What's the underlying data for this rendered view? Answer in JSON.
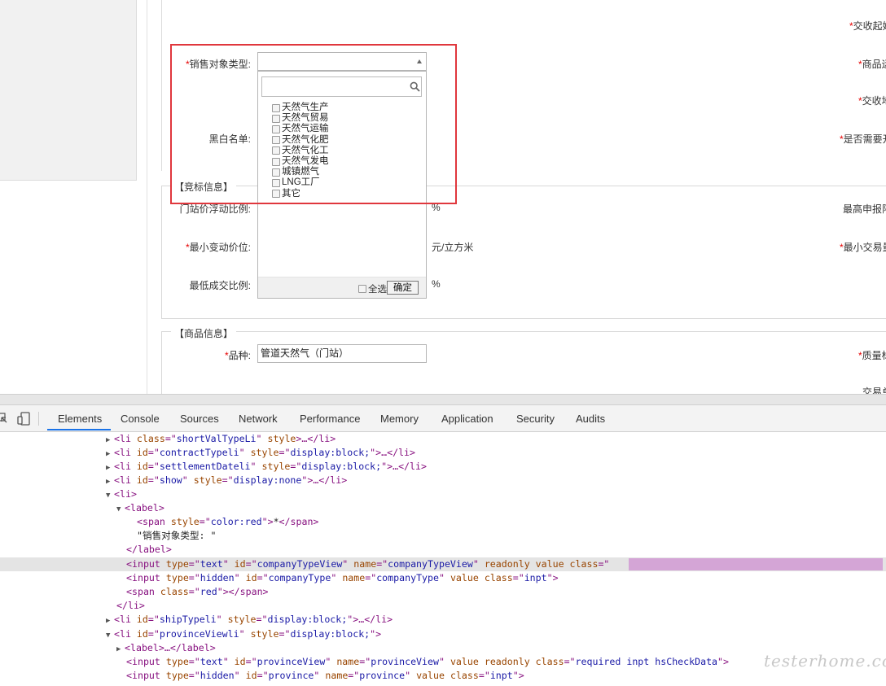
{
  "form": {
    "right_labels": [
      "*交收起始",
      "*商品运",
      "*交收地",
      "*是否需要开",
      "最高申报限",
      "*最小交易量",
      "*质量标",
      "交易单"
    ],
    "sales_target_label": "销售对象类型:",
    "sales_target_required_mark": "*",
    "blacklist_label": "黑白名单:",
    "bidding_section_legend": "【竞标信息】",
    "gate_price_label": "门站价浮动比例:",
    "gate_price_unit": "%",
    "min_change_label": "最小变动价位:",
    "min_change_required_mark": "*",
    "min_change_unit": "元/立方米",
    "min_deal_label": "最低成交比例:",
    "min_deal_unit": "%",
    "goods_section_legend": "【商品信息】",
    "variety_label": "品种:",
    "variety_required_mark": "*",
    "variety_value": "管道天然气（门站）"
  },
  "dropdown": {
    "search_value": "",
    "options": [
      "天然气生产",
      "天然气贸易",
      "天然气运输",
      "天然气化肥",
      "天然气化工",
      "天然气发电",
      "城镇燃气",
      "LNG工厂",
      "其它"
    ],
    "select_all_label": "全选",
    "ok_label": "确定"
  },
  "devtools": {
    "tabs": [
      "Elements",
      "Console",
      "Sources",
      "Network",
      "Performance",
      "Memory",
      "Application",
      "Security",
      "Audits"
    ],
    "active_tab": "Elements",
    "accent_color": "#1a73e8"
  },
  "watermark": "testerhome.com"
}
